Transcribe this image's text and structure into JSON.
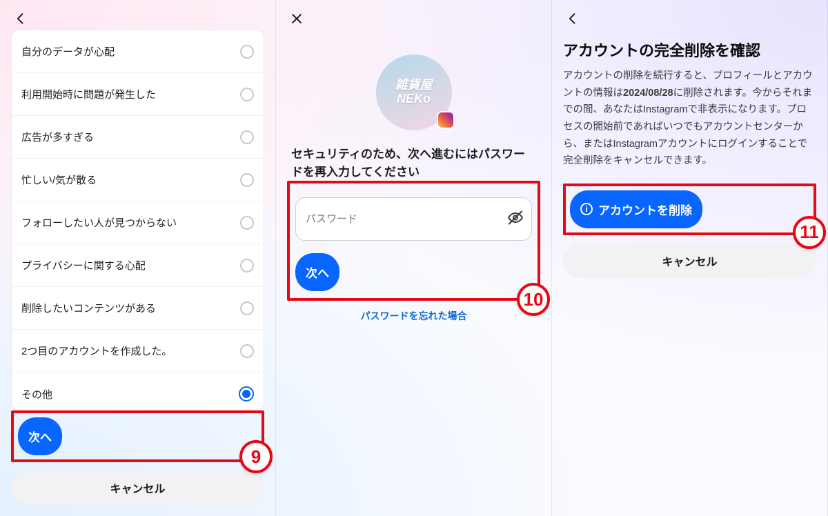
{
  "panel1": {
    "reasons": [
      {
        "label": "自分のデータが心配",
        "selected": false
      },
      {
        "label": "利用開始時に問題が発生した",
        "selected": false
      },
      {
        "label": "広告が多すぎる",
        "selected": false
      },
      {
        "label": "忙しい/気が散る",
        "selected": false
      },
      {
        "label": "フォローしたい人が見つからない",
        "selected": false
      },
      {
        "label": "プライバシーに関する心配",
        "selected": false
      },
      {
        "label": "削除したいコンテンツがある",
        "selected": false
      },
      {
        "label": "2つ目のアカウントを作成した。",
        "selected": false
      },
      {
        "label": "その他",
        "selected": true
      }
    ],
    "next_label": "次へ",
    "cancel_label": "キャンセル",
    "step_number": "9"
  },
  "panel2": {
    "avatar": {
      "line1": "雑貨屋",
      "line2": "NEKo"
    },
    "heading": "セキュリティのため、次へ進むにはパスワードを再入力してください",
    "password_placeholder": "パスワード",
    "next_label": "次へ",
    "forgot_label": "パスワードを忘れた場合",
    "step_number": "10"
  },
  "panel3": {
    "title": "アカウントの完全削除を確認",
    "body_pre": "アカウントの削除を続行すると、プロフィールとアカウントの情報は",
    "body_date": "2024/08/28",
    "body_post": "に削除されます。今からそれまでの間、あなたはInstagramで非表示になります。プロセスの開始前であればいつでもアカウントセンターから、またはInstagramアカウントにログインすることで完全削除をキャンセルできます。",
    "delete_label": "アカウントを削除",
    "cancel_label": "キャンセル",
    "step_number": "11"
  }
}
